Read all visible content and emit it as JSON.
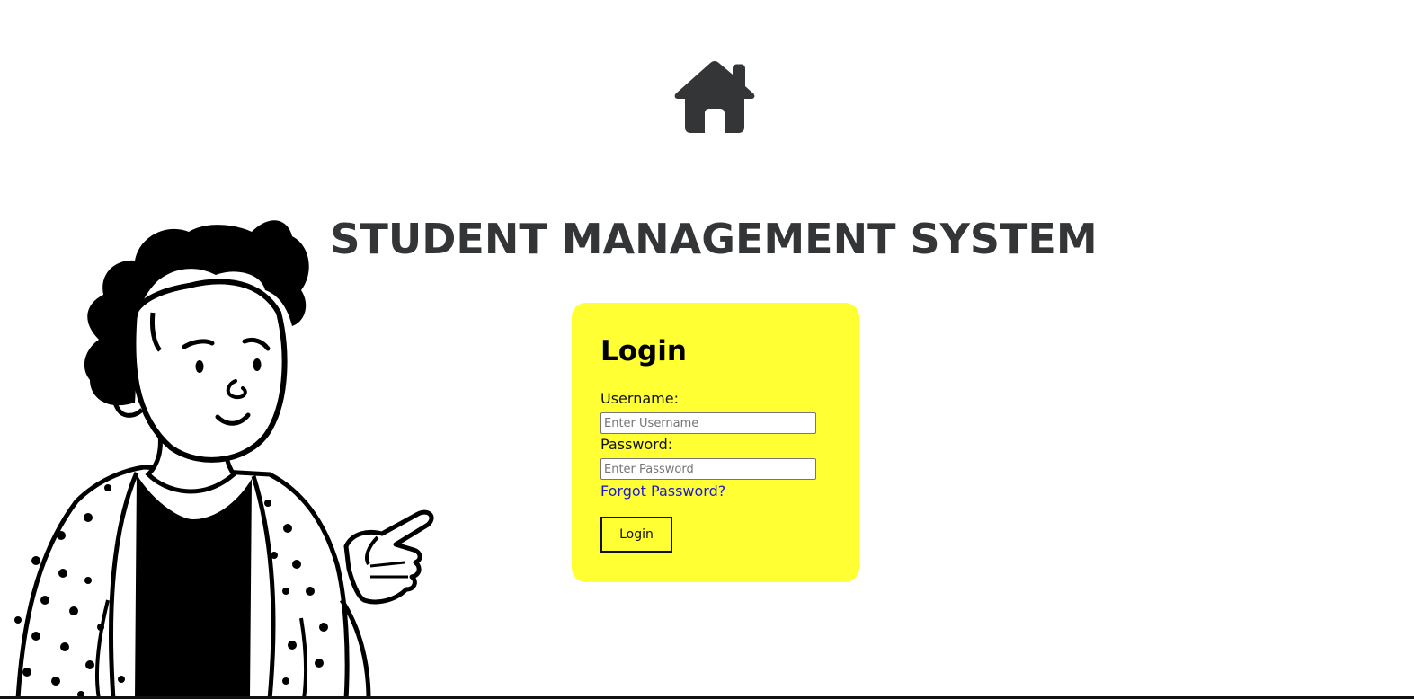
{
  "header": {
    "home_icon": "home-icon",
    "title": "STUDENT MANAGEMENT SYSTEM"
  },
  "illustration": {
    "icon": "pointing-person-illustration"
  },
  "login_form": {
    "heading": "Login",
    "username_label": "Username:",
    "username_placeholder": "Enter Username",
    "username_value": "",
    "password_label": "Password:",
    "password_placeholder": "Enter Password",
    "password_value": "",
    "forgot_password_link": "Forgot Password?",
    "login_button": "Login"
  },
  "colors": {
    "background": "#ffffff",
    "title": "#333537",
    "card": "#ffff33",
    "link": "#1a1ad6",
    "icon": "#333537"
  }
}
